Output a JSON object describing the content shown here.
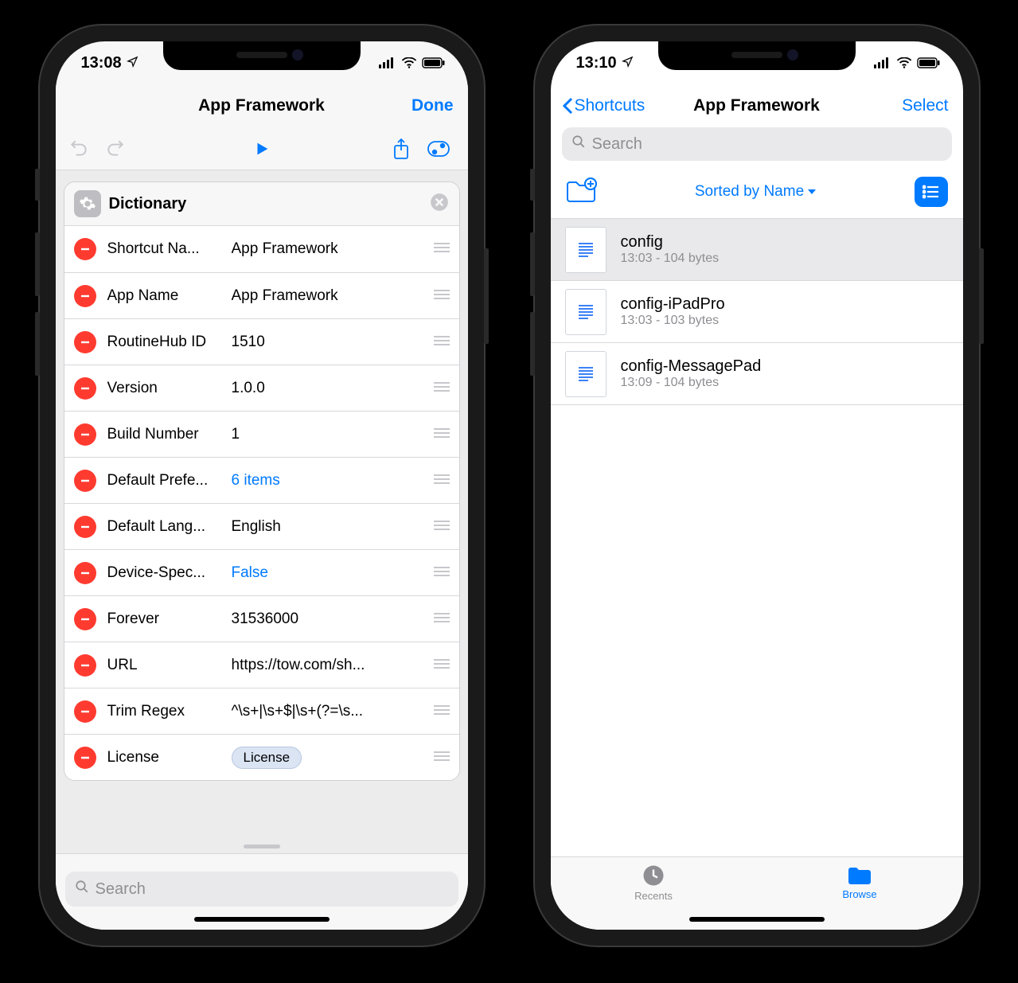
{
  "left": {
    "status_time": "13:08",
    "nav_title": "App Framework",
    "done": "Done",
    "card_title": "Dictionary",
    "rows": [
      {
        "key": "Shortcut Na...",
        "value": "App Framework",
        "link": false
      },
      {
        "key": "App Name",
        "value": "App Framework",
        "link": false
      },
      {
        "key": "RoutineHub ID",
        "value": "1510",
        "link": false
      },
      {
        "key": "Version",
        "value": "1.0.0",
        "link": false
      },
      {
        "key": "Build Number",
        "value": "1",
        "link": false
      },
      {
        "key": "Default Prefe...",
        "value": "6 items",
        "link": true
      },
      {
        "key": "Default Lang...",
        "value": "English",
        "link": false
      },
      {
        "key": "Device-Spec...",
        "value": "False",
        "link": true
      },
      {
        "key": "Forever",
        "value": "31536000",
        "link": false
      },
      {
        "key": "URL",
        "value": "https://tow.com/sh...",
        "link": false
      },
      {
        "key": "Trim Regex",
        "value": "^\\s+|\\s+$|\\s+(?=\\s...",
        "link": false
      },
      {
        "key": "License",
        "value": "License",
        "link": false,
        "token": true
      }
    ],
    "search_placeholder": "Search"
  },
  "right": {
    "status_time": "13:10",
    "back_label": "Shortcuts",
    "nav_title": "App Framework",
    "select_label": "Select",
    "search_placeholder": "Search",
    "sort_label": "Sorted by Name",
    "files": [
      {
        "name": "config",
        "meta": "13:03 - 104 bytes",
        "selected": true
      },
      {
        "name": "config-iPadPro",
        "meta": "13:03 - 103 bytes",
        "selected": false
      },
      {
        "name": "config-MessagePad",
        "meta": "13:09 - 104 bytes",
        "selected": false
      }
    ],
    "tab_recents": "Recents",
    "tab_browse": "Browse"
  },
  "colors": {
    "blue": "#007aff",
    "red": "#ff3b30"
  }
}
